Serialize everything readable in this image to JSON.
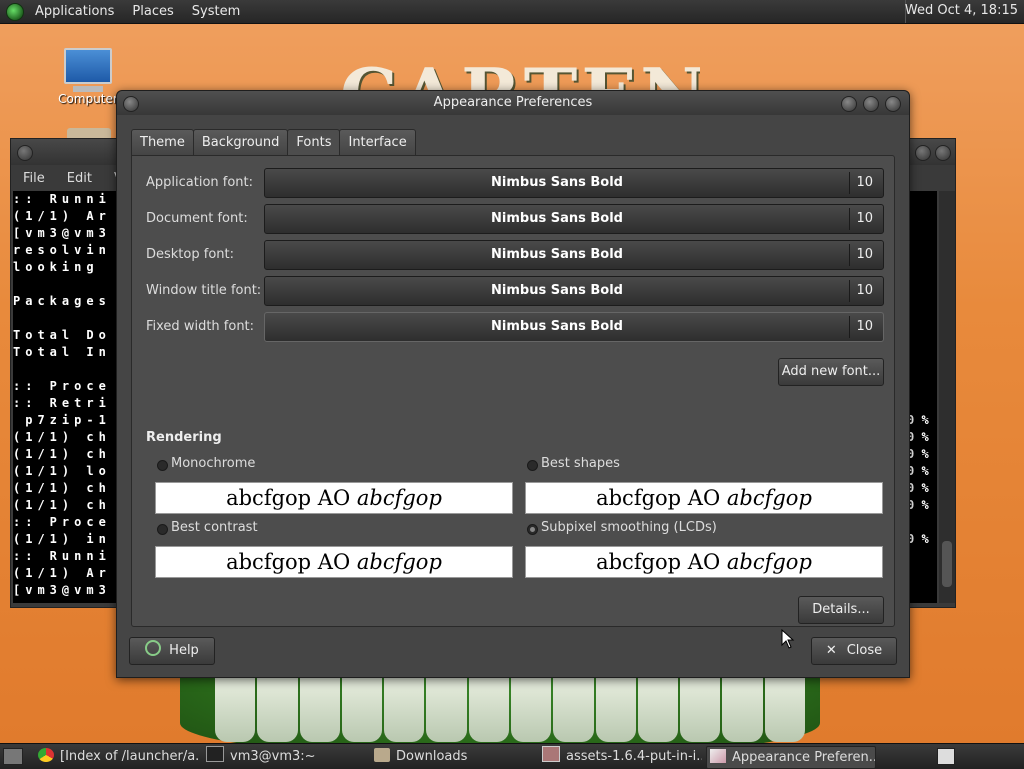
{
  "top_panel": {
    "menus": [
      "Applications",
      "Places",
      "System"
    ],
    "clock": "Wed Oct  4, 18:15"
  },
  "wallpaper": {
    "title_fragment": "CARTENOF"
  },
  "desktop": {
    "icons": [
      {
        "label": "Computer"
      }
    ]
  },
  "terminal": {
    "menus": [
      "File",
      "Edit",
      "V"
    ],
    "lines": [
      ":: Runni",
      "(1/1) Ar",
      "[vm3@vm3",
      "resolvin",
      "looking",
      "",
      "Packages",
      "",
      "Total Do",
      "Total In",
      "",
      ":: Proce",
      ":: Retri",
      " p7zip-1",
      "(1/1) ch",
      "(1/1) ch",
      "(1/1) lo",
      "(1/1) ch",
      "(1/1) ch",
      ":: Proce",
      "(1/1) in",
      ":: Runni",
      "(1/1) Ar",
      "[vm3@vm3"
    ],
    "right_lines": [
      "",
      "",
      "",
      "",
      "",
      "",
      "",
      "",
      "",
      "",
      "",
      "",
      "",
      "0 %",
      "0 %",
      "0 %",
      "0 %",
      "0 %",
      "0 %",
      "",
      "0 %",
      "",
      "",
      ""
    ]
  },
  "dialog": {
    "title": "Appearance Preferences",
    "tabs": [
      "Theme",
      "Background",
      "Fonts",
      "Interface"
    ],
    "active_tab": "Fonts",
    "fonts": [
      {
        "label": "Application font:",
        "font": "Nimbus Sans Bold",
        "size": "10"
      },
      {
        "label": "Document font:",
        "font": "Nimbus Sans Bold",
        "size": "10"
      },
      {
        "label": "Desktop font:",
        "font": "Nimbus Sans Bold",
        "size": "10"
      },
      {
        "label": "Window title font:",
        "font": "Nimbus Sans Bold",
        "size": "10"
      },
      {
        "label": "Fixed width font:",
        "font": "Nimbus Sans Bold",
        "size": "10"
      }
    ],
    "add_font_label": "Add new font...",
    "rendering": {
      "heading": "Rendering",
      "sample_plain": "abcfgop AO ",
      "sample_italic": "abcfgop",
      "options": [
        {
          "label": "Monochrome",
          "selected": false
        },
        {
          "label": "Best shapes",
          "selected": false
        },
        {
          "label": "Best contrast",
          "selected": false
        },
        {
          "label": "Subpixel smoothing (LCDs)",
          "selected": true
        }
      ]
    },
    "details_label": "Details...",
    "help_label": "Help",
    "close_label": "Close"
  },
  "taskbar": {
    "tasks": [
      {
        "label": "[Index of /launcher/a...",
        "icon": "chrome-icon"
      },
      {
        "label": "vm3@vm3:~",
        "icon": "terminal-icon"
      },
      {
        "label": "Downloads",
        "icon": "folder-icon"
      },
      {
        "label": "assets-1.6.4-put-in-i...",
        "icon": "archive-icon"
      },
      {
        "label": "Appearance Preferen...",
        "icon": "appearance-icon"
      }
    ]
  }
}
